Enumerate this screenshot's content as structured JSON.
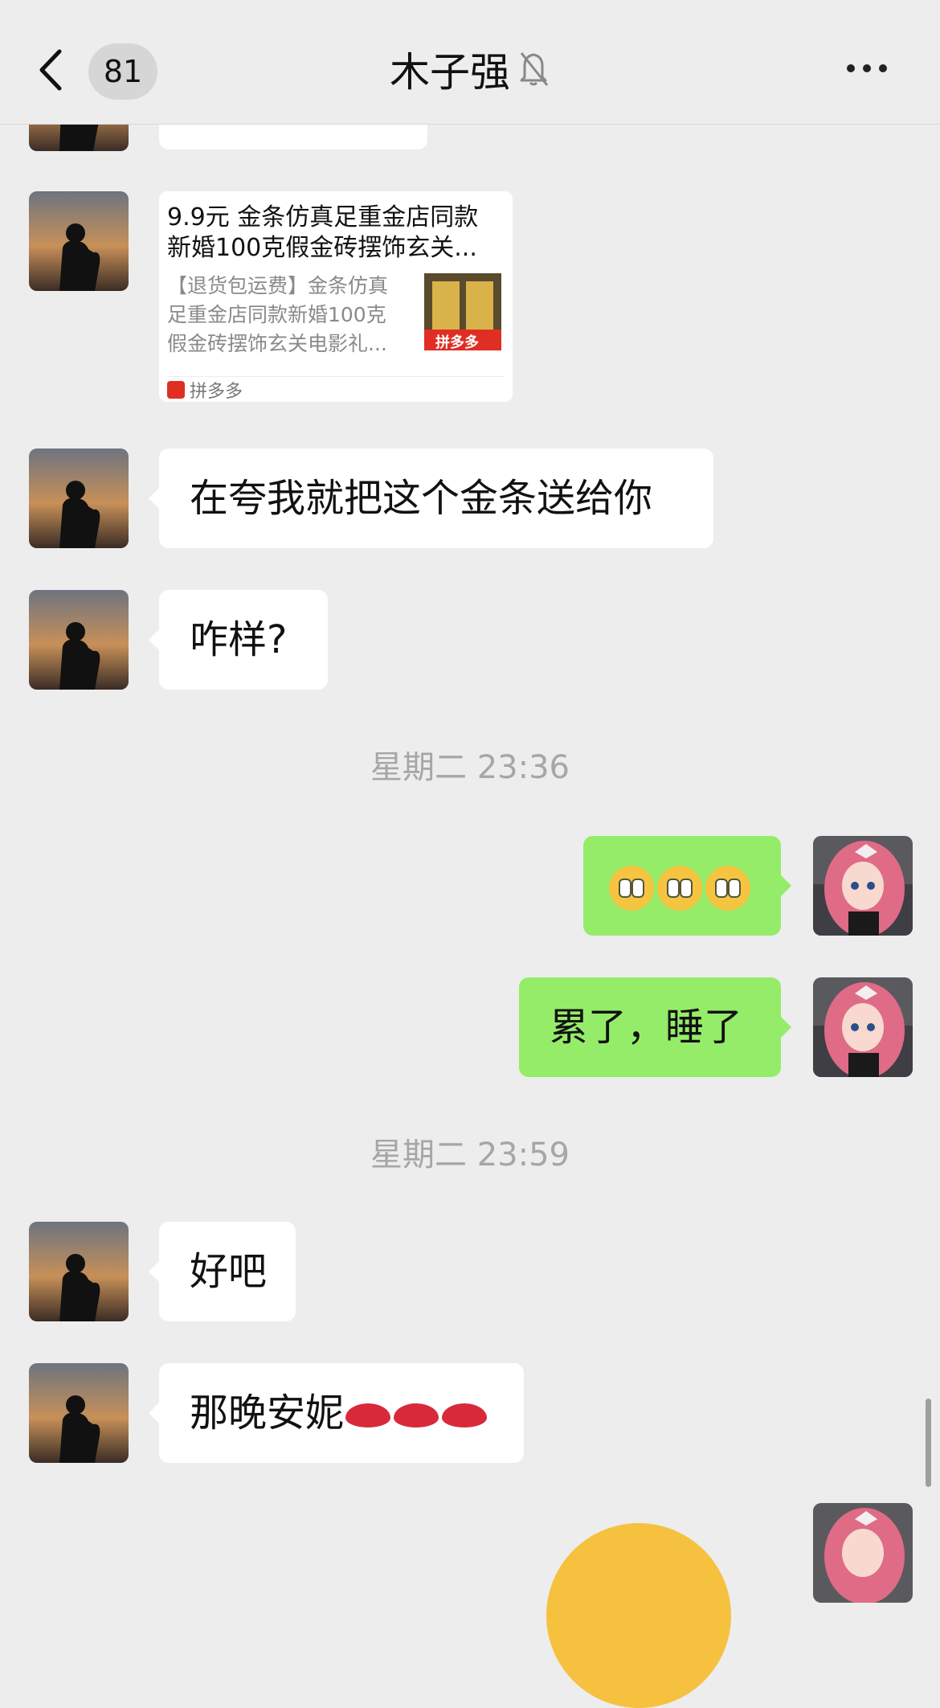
{
  "header": {
    "unread_count": "81",
    "title": "木子强",
    "back_icon": "chevron-left-icon",
    "mute_icon": "bell-off-icon",
    "more_icon": "more-icon"
  },
  "link_card": {
    "title": "9.9元 金条仿真足重金店同款\n新婚100克假金砖摆饰玄关...",
    "description": "【退货包运费】金条仿真\n足重金店同款新婚100克\n假金砖摆饰玄关电影礼...",
    "thumb_badge": "拼多多",
    "source": "拼多多"
  },
  "messages": {
    "m1": "在夸我就把这个金条送给你",
    "m2": "咋样?",
    "time1": "星期二 23:36",
    "m4": "累了，睡了",
    "time2": "星期二 23:59",
    "m5": "好吧",
    "m6": "那晚安妮"
  },
  "colors": {
    "background": "#ededed",
    "sent_bubble": "#95ec69",
    "received_bubble": "#ffffff"
  }
}
